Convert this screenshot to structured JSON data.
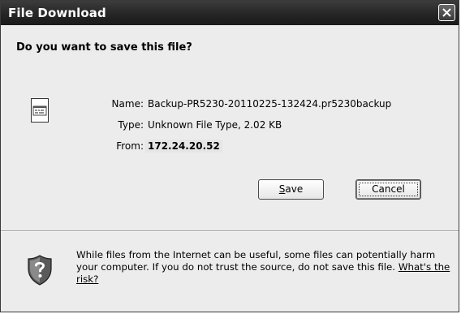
{
  "window": {
    "title": "File Download"
  },
  "dialog": {
    "question": "Do you want to save this file?",
    "file": {
      "name_label": "Name:",
      "name_value": "Backup-PR5230-20110225-132424.pr5230backup",
      "type_label": "Type:",
      "type_value": "Unknown File Type, 2.02 KB",
      "from_label": "From:",
      "from_value": "172.24.20.52"
    },
    "buttons": {
      "save": "Save",
      "save_hotkey": "S",
      "save_rest": "ave",
      "cancel": "Cancel"
    },
    "warning": {
      "text": "While files from the Internet can be useful, some files can potentially harm your computer. If you do not trust the source, do not save this file.",
      "link": "What's the risk?"
    }
  },
  "icons": {
    "file": "file-icon",
    "shield": "shield-warning-icon",
    "close": "close-icon"
  }
}
